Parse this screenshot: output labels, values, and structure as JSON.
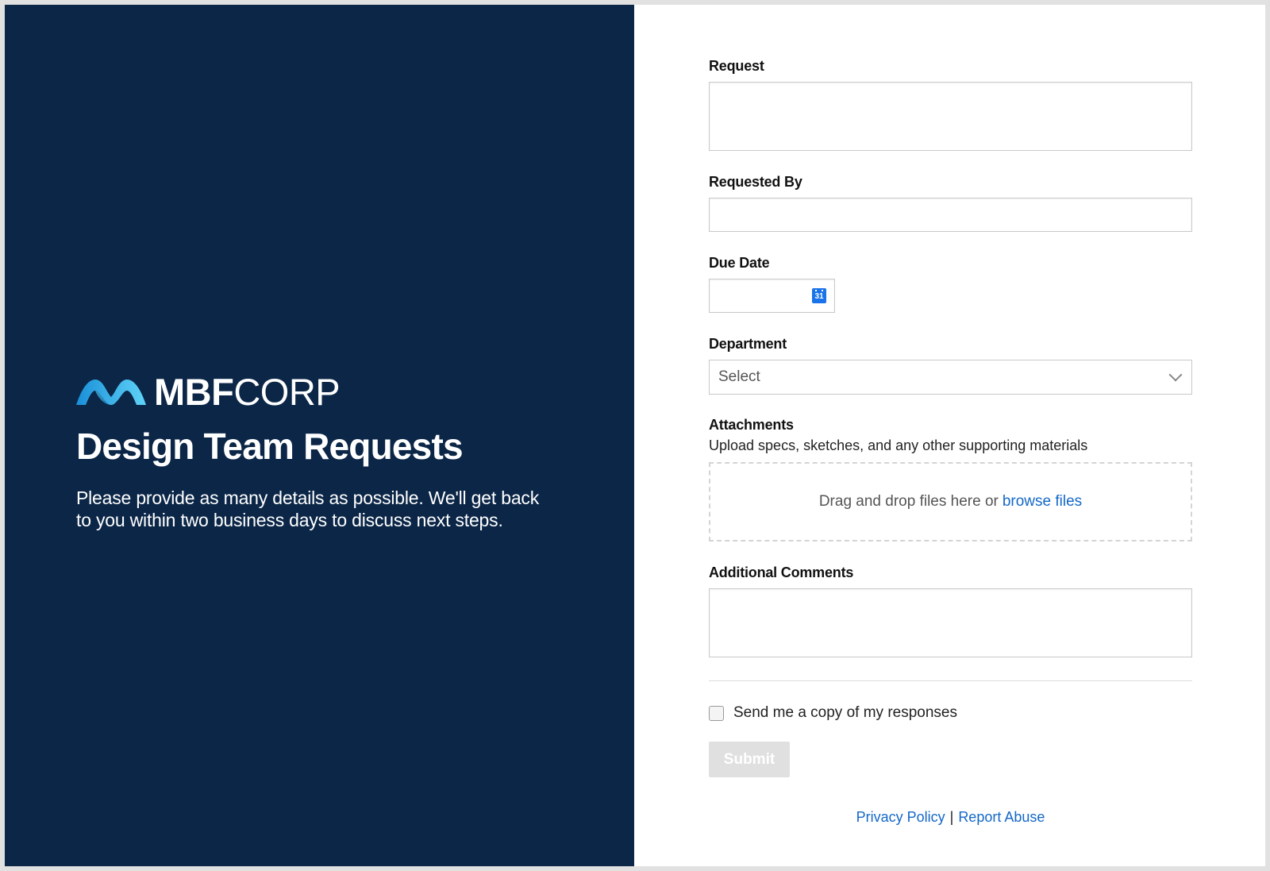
{
  "colors": {
    "brand_bg": "#0b2647",
    "link": "#1468c7",
    "logo_gradient_start": "#1fa8e8",
    "logo_gradient_end": "#6fe0ff"
  },
  "brand": {
    "logo_bold": "MBF",
    "logo_light": "CORP",
    "logo_icon": "wave-logo-icon",
    "title": "Design Team Requests",
    "intro": "Please provide as many details as possible. We'll get back to you within two business days to discuss next steps."
  },
  "form": {
    "request": {
      "label": "Request",
      "value": ""
    },
    "requested_by": {
      "label": "Requested By",
      "value": ""
    },
    "due_date": {
      "label": "Due Date",
      "value": "",
      "icon": "calendar-icon",
      "icon_text": "31"
    },
    "department": {
      "label": "Department",
      "placeholder": "Select",
      "icon": "chevron-down-icon"
    },
    "attachments": {
      "label": "Attachments",
      "description": "Upload specs, sketches, and any other supporting materials",
      "dropzone_text": "Drag and drop files here or",
      "browse_link": "browse files"
    },
    "comments": {
      "label": "Additional Comments",
      "value": ""
    },
    "copy_checkbox": {
      "label": "Send me a copy of my responses",
      "checked": false
    },
    "submit_label": "Submit"
  },
  "footer": {
    "privacy": "Privacy Policy",
    "separator": "|",
    "report": "Report Abuse"
  }
}
